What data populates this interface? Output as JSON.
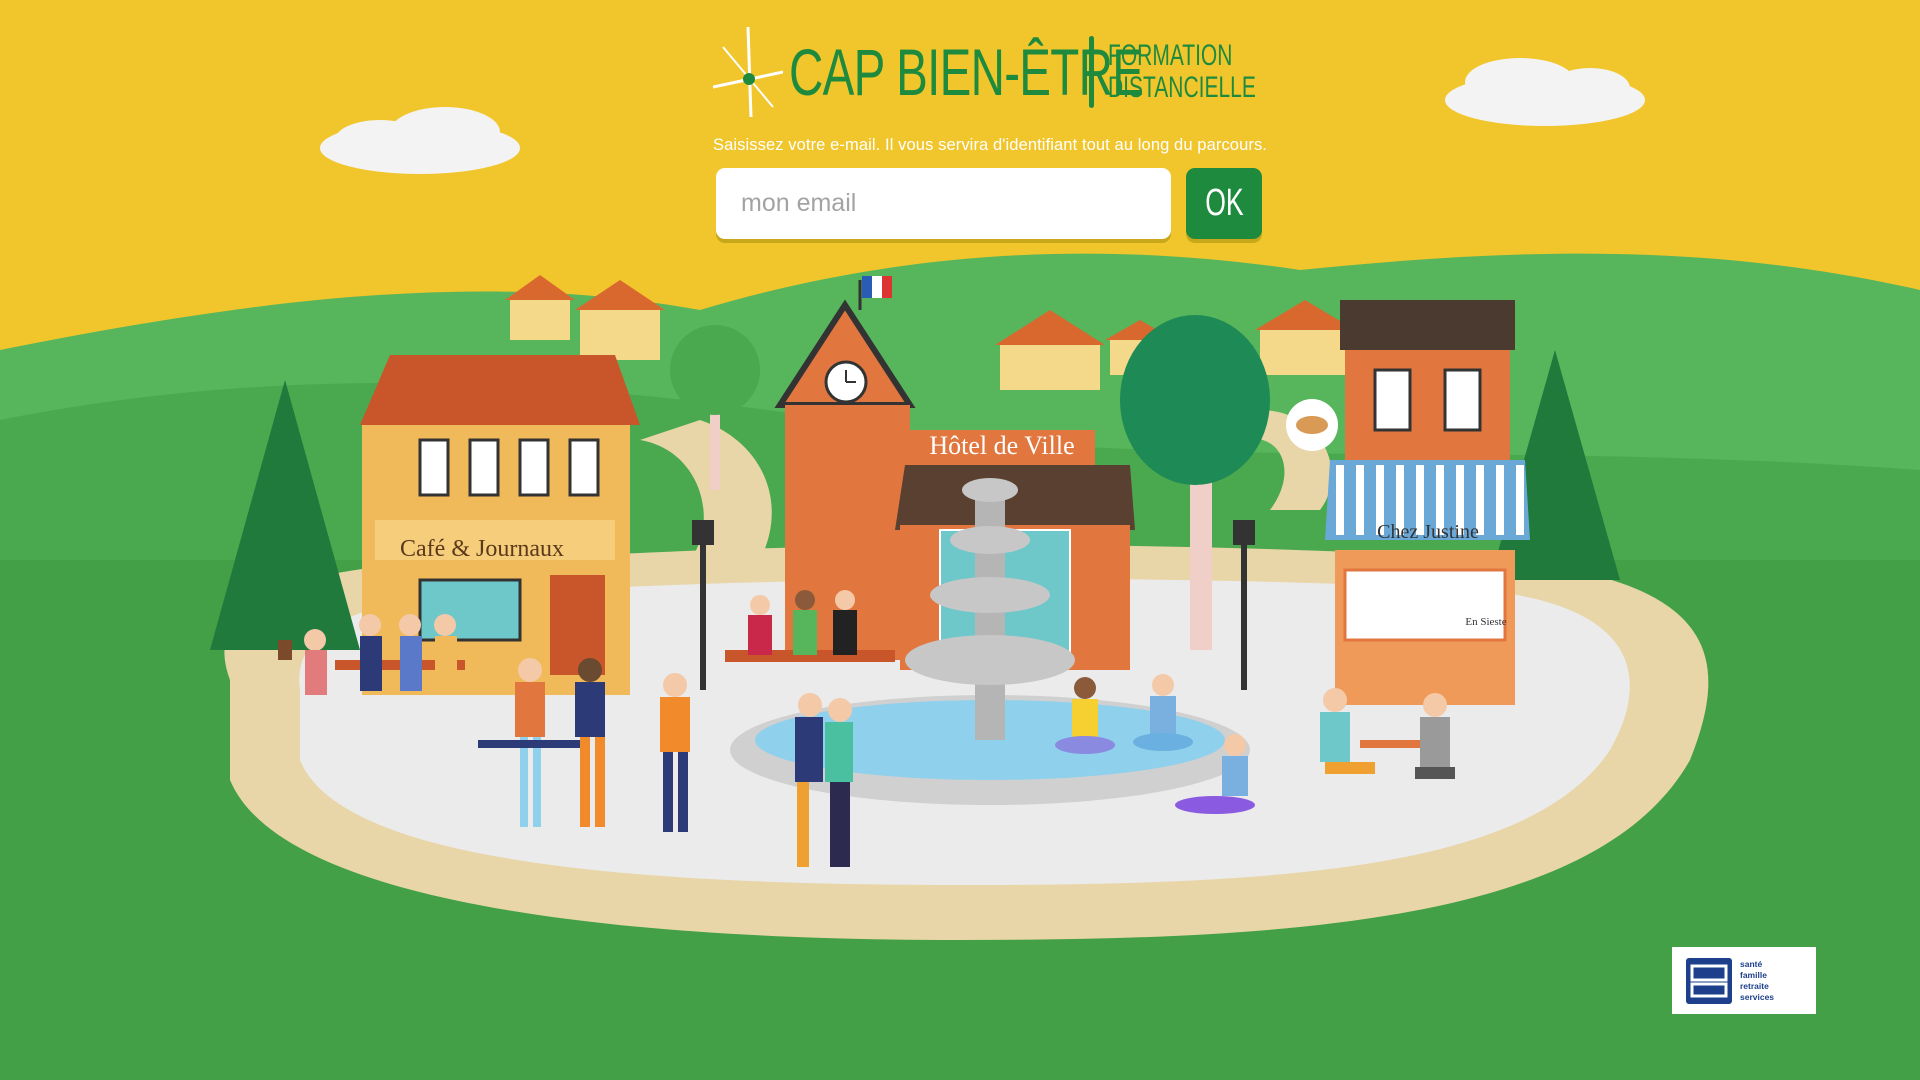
{
  "brand": {
    "name": "CAP BIEN-ÊTRE",
    "subtitle_line1": "FORMATION",
    "subtitle_line2": "DISTANCIELLE",
    "color": "#1e8a3e"
  },
  "instructions": "Saisissez votre e-mail. Il vous servira d'identifiant tout au long du parcours.",
  "email_form": {
    "placeholder": "mon email",
    "value": "",
    "submit_label": "OK"
  },
  "village_signs": {
    "cafe": "Café & Journaux",
    "town_hall": "Hôtel de Ville",
    "shop": "Chez Justine",
    "shop_window": "En Sieste"
  },
  "partner": {
    "mark": "msa",
    "lines": [
      "santé",
      "famille",
      "retraite",
      "services"
    ]
  },
  "colors": {
    "sky": "#f1c62c",
    "hill_light": "#57b55c",
    "hill_dark": "#44a047",
    "plaza": "#e9e9e9",
    "path": "#e8d6a8",
    "button": "#1e8a3e"
  }
}
